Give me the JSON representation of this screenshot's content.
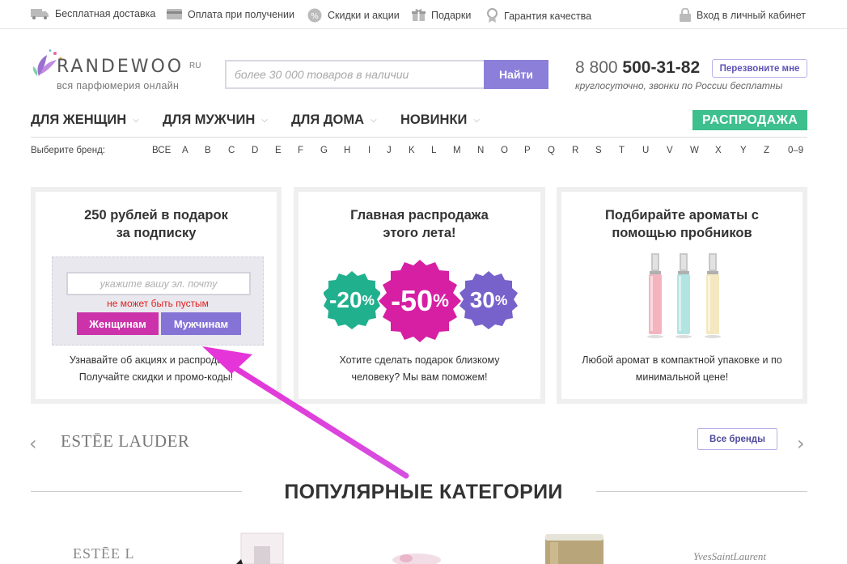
{
  "topbar": {
    "delivery": "Бесплатная доставка",
    "payment": "Оплата при получении",
    "discounts": "Скидки и акции",
    "gifts": "Подарки",
    "guarantee": "Гарантия качества",
    "login": "Вход в личный кабинет"
  },
  "logo": {
    "name": "RANDEWOO",
    "ru": "RU",
    "tagline": "вся парфюмерия онлайн"
  },
  "search": {
    "placeholder": "более 30 000 товаров в наличии",
    "button": "Найти"
  },
  "contact": {
    "phone_prefix": "8 800",
    "phone_main": "500-31-82",
    "note": "круглосуточно, звонки по России бесплатны",
    "callback": "Перезвоните мне"
  },
  "nav": {
    "items": [
      "ДЛЯ ЖЕНЩИН",
      "ДЛЯ МУЖЧИН",
      "ДЛЯ ДОМА",
      "НОВИНКИ"
    ],
    "sale": "РАСПРОДАЖА"
  },
  "brands": {
    "label": "Выберите бренд:",
    "letters": [
      "ВСЕ",
      "A",
      "B",
      "C",
      "D",
      "E",
      "F",
      "G",
      "H",
      "I",
      "J",
      "K",
      "L",
      "M",
      "N",
      "O",
      "P",
      "Q",
      "R",
      "S",
      "T",
      "U",
      "V",
      "W",
      "X",
      "Y",
      "Z",
      "0–9"
    ]
  },
  "cards": {
    "subscribe": {
      "title": "250 рублей в подарок\nза подписку",
      "email_placeholder": "укажите вашу эл. почту",
      "error": "не может быть пустым",
      "btn_women": "Женщинам",
      "btn_men": "Мужчинам",
      "text1": "Узнавайте об акциях и распродажах!",
      "text2": "Получайте скидки и промо-коды!"
    },
    "sale": {
      "title": "Главная распродажа\nэтого лета!",
      "badges": [
        "-20",
        "-50",
        "30"
      ],
      "pct": "%",
      "text1": "Хотите сделать подарок близкому",
      "text2": "человеку? Мы вам поможем!"
    },
    "samples": {
      "title": "Подбирайте ароматы с\nпомощью пробников",
      "text1": "Любой аромат в компактной упаковке и по",
      "text2": "минимальной цене!"
    }
  },
  "carousel": {
    "brand": "ESTĒE LAUDER",
    "all_brands": "Все бренды",
    "prev": "‹",
    "next": "›"
  },
  "categories": {
    "title": "ПОПУЛЯРНЫЕ КАТЕГОРИИ",
    "brand_left": "ESTĒE L",
    "brand_right": "YvesSaintLaurent"
  },
  "colors": {
    "accent_purple": "#8b7fd9",
    "sale_green": "#3dbf8e",
    "women_magenta": "#cc33aa",
    "men_violet": "#8574d6",
    "error_red": "#e02020",
    "arrow_magenta": "#e535d8"
  }
}
